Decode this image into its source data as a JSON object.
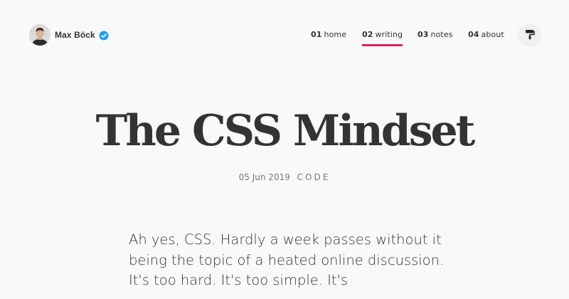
{
  "brand": {
    "name": "Max Böck",
    "avatar_icon": "avatar-photo",
    "verified_icon": "verified-badge-icon",
    "verified_color": "#1da1f2"
  },
  "nav": {
    "items": [
      {
        "num": "01",
        "label": "home",
        "active": false
      },
      {
        "num": "02",
        "label": "writing",
        "active": true
      },
      {
        "num": "03",
        "label": "notes",
        "active": false
      },
      {
        "num": "04",
        "label": "about",
        "active": false
      }
    ],
    "accent_color": "#e0245e",
    "theme_toggle_icon": "paint-roller-icon"
  },
  "article": {
    "title": "The CSS Mindset",
    "date": "05 Jun 2019",
    "separator_glyph": "",
    "tag": "CODE",
    "lead": "Ah yes, CSS. Hardly a week passes without it being the topic of a heated online discussion. It's too hard. It's too simple. It's"
  }
}
